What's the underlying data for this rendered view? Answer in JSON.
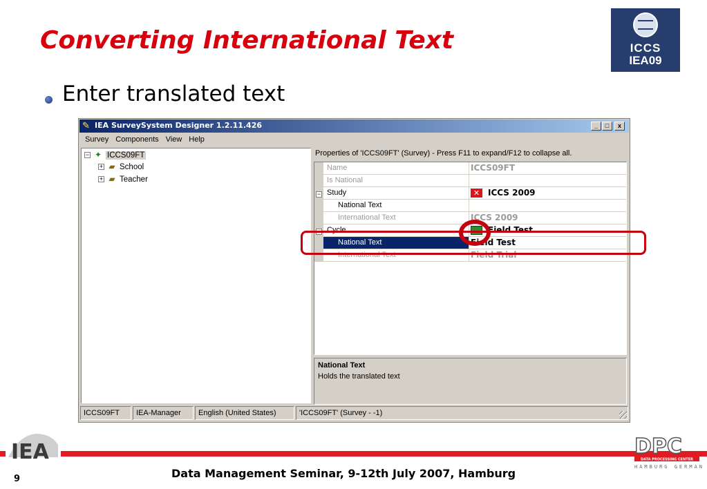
{
  "slide": {
    "title": "Converting International Text",
    "bullet": "Enter translated text",
    "footer_text": "Data Management Seminar, 9-12th July 2007, Hamburg",
    "page_number": "9"
  },
  "logos": {
    "iccs_line1": "ICCS",
    "iccs_line2": "IEA09",
    "iea": "IEA",
    "dpc": "DPC",
    "dpc_sub": "DATA PROCESSING CENTER",
    "dpc_city": "HAMBURG GERMANY"
  },
  "window": {
    "title": "IEA SurveySystem Designer 1.2.11.426",
    "controls": {
      "minimize": "_",
      "maximize": "□",
      "close": "x"
    },
    "menu": [
      "Survey",
      "Components",
      "View",
      "Help"
    ]
  },
  "tree": {
    "root": "ICCS09FT",
    "children": [
      "School",
      "Teacher"
    ]
  },
  "properties": {
    "header": "Properties of 'ICCS09FT' (Survey) - Press F11 to expand/F12 to collapse all.",
    "rows": [
      {
        "name": "Name",
        "value": "ICCS09FT"
      },
      {
        "name": "Is National",
        "value": ""
      },
      {
        "name": "Study",
        "value": "ICCS 2009"
      },
      {
        "name": "National Text",
        "value": ""
      },
      {
        "name": "International Text",
        "value": "ICCS 2009"
      },
      {
        "name": "Cycle",
        "value": "Field Test"
      },
      {
        "name": "National Text",
        "value": "Field Test"
      },
      {
        "name": "International Text",
        "value": "Field Trial"
      }
    ],
    "description_title": "National Text",
    "description_text": "Holds the translated text"
  },
  "status": {
    "panels": [
      "ICCS09FT",
      "IEA-Manager",
      "English (United States)",
      "'ICCS09FT' (Survey - -1)"
    ]
  },
  "colors": {
    "accent_red": "#d8000c",
    "selection_blue": "#0a246a",
    "logo_navy": "#263d6e"
  },
  "icons": {
    "app": "app-icon",
    "survey": "survey-globe-icon",
    "folder": "folder-icon",
    "error": "red-x-icon",
    "ok": "green-check-icon"
  }
}
